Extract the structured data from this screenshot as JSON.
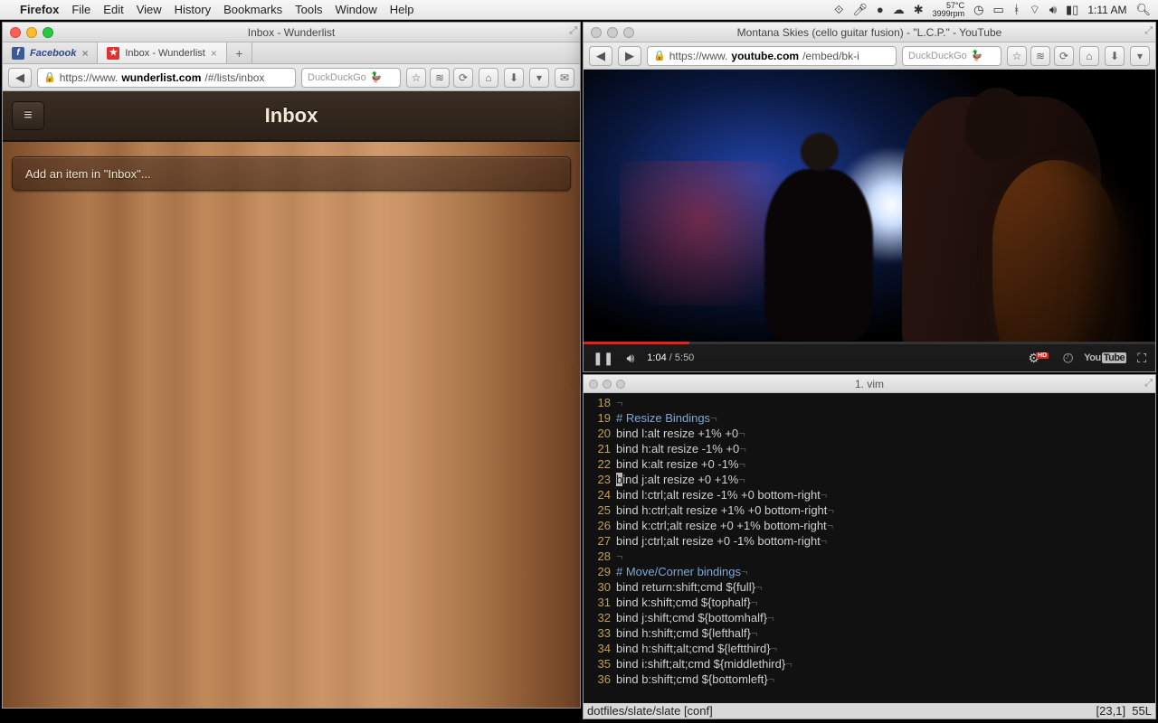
{
  "menubar": {
    "app": "Firefox",
    "items": [
      "File",
      "Edit",
      "View",
      "History",
      "Bookmarks",
      "Tools",
      "Window",
      "Help"
    ],
    "temp_top": "57°C",
    "temp_bot": "3999rpm",
    "clock": "1:11 AM"
  },
  "left_window": {
    "title": "Inbox - Wunderlist",
    "tabs": [
      {
        "label": "Facebook",
        "kind": "fb"
      },
      {
        "label": "Inbox - Wunderlist",
        "kind": "wl",
        "active": true
      }
    ],
    "url_prefix": "https://www.",
    "url_host": "wunderlist.com",
    "url_path": "/#/lists/inbox",
    "search_engine": "DuckDuckGo",
    "page": {
      "header": "Inbox",
      "add_placeholder": "Add an item in \"Inbox\"..."
    }
  },
  "right_top_window": {
    "title": "Montana Skies (cello guitar fusion) - \"L.C.P.\" - YouTube",
    "url_prefix": "https://www.",
    "url_host": "youtube.com",
    "url_path": "/embed/bk-i",
    "search_engine": "DuckDuckGo",
    "player": {
      "current": "1:04",
      "duration": "5:50",
      "progress_pct": 18.5,
      "logo_a": "You",
      "logo_b": "Tube"
    }
  },
  "right_bot_window": {
    "title": "1. vim",
    "lines": [
      {
        "n": 18,
        "t": "¬",
        "cls": ""
      },
      {
        "n": 19,
        "t": "# Resize Bindings¬",
        "cls": "cm"
      },
      {
        "n": 20,
        "t": "bind l:alt resize +1% +0¬",
        "cls": ""
      },
      {
        "n": 21,
        "t": "bind h:alt resize -1% +0¬",
        "cls": ""
      },
      {
        "n": 22,
        "t": "bind k:alt resize +0 -1%¬",
        "cls": ""
      },
      {
        "n": 23,
        "t": "bind j:alt resize +0 +1%¬",
        "cls": "",
        "cursor": true
      },
      {
        "n": 24,
        "t": "bind l:ctrl;alt resize -1% +0 bottom-right¬",
        "cls": ""
      },
      {
        "n": 25,
        "t": "bind h:ctrl;alt resize +1% +0 bottom-right¬",
        "cls": ""
      },
      {
        "n": 26,
        "t": "bind k:ctrl;alt resize +0 +1% bottom-right¬",
        "cls": ""
      },
      {
        "n": 27,
        "t": "bind j:ctrl;alt resize +0 -1% bottom-right¬",
        "cls": ""
      },
      {
        "n": 28,
        "t": "¬",
        "cls": ""
      },
      {
        "n": 29,
        "t": "# Move/Corner bindings¬",
        "cls": "cm"
      },
      {
        "n": 30,
        "t": "bind return:shift;cmd ${full}¬",
        "cls": ""
      },
      {
        "n": 31,
        "t": "bind k:shift;cmd ${tophalf}¬",
        "cls": ""
      },
      {
        "n": 32,
        "t": "bind j:shift;cmd ${bottomhalf}¬",
        "cls": ""
      },
      {
        "n": 33,
        "t": "bind h:shift;cmd ${lefthalf}¬",
        "cls": ""
      },
      {
        "n": 34,
        "t": "bind h:shift;alt;cmd ${leftthird}¬",
        "cls": ""
      },
      {
        "n": 35,
        "t": "bind i:shift;alt;cmd ${middlethird}¬",
        "cls": ""
      },
      {
        "n": 36,
        "t": "bind b:shift;cmd ${bottomleft}¬",
        "cls": ""
      }
    ],
    "status_left": "dotfiles/slate/slate [conf]",
    "status_right": "[23,1]  55L"
  }
}
